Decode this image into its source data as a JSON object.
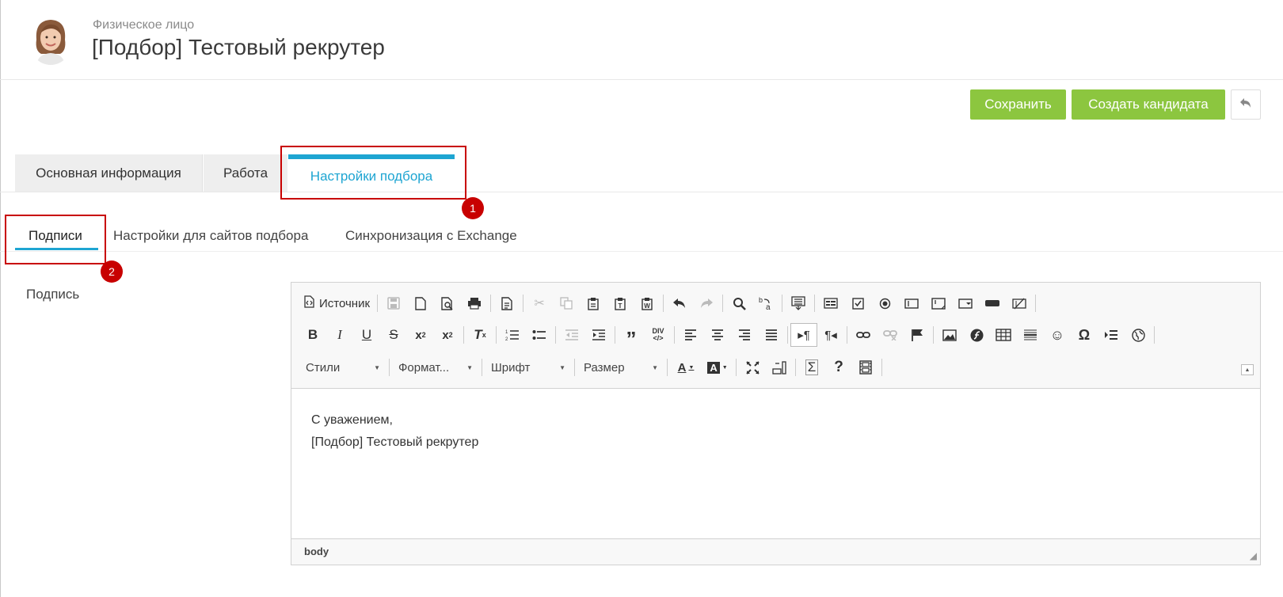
{
  "header": {
    "subtitle": "Физическое лицо",
    "title": "[Подбор] Тестовый рекрутер"
  },
  "actions": {
    "save_label": "Сохранить",
    "create_candidate_label": "Создать кандидата"
  },
  "tabs": [
    {
      "label": "Основная информация",
      "active": false
    },
    {
      "label": "Работа",
      "active": false
    },
    {
      "label": "Настройки подбора",
      "active": true
    }
  ],
  "subtabs": [
    {
      "label": "Подписи",
      "active": true
    },
    {
      "label": "Настройки для сайтов подбора",
      "active": false
    },
    {
      "label": "Синхронизация с Exchange",
      "active": false
    }
  ],
  "annotations": [
    "1",
    "2"
  ],
  "field": {
    "label": "Подпись"
  },
  "editor": {
    "source_label": "Источник",
    "combos": {
      "styles": "Стили",
      "format": "Формат...",
      "font": "Шрифт",
      "size": "Размер"
    },
    "content_lines": [
      "С уважением,",
      "[Подбор] Тестовый рекрутер"
    ],
    "status_path": "body"
  },
  "colors": {
    "accent": "#1ea5d2",
    "button_green": "#8cc63f",
    "annotation_red": "#c80000"
  }
}
